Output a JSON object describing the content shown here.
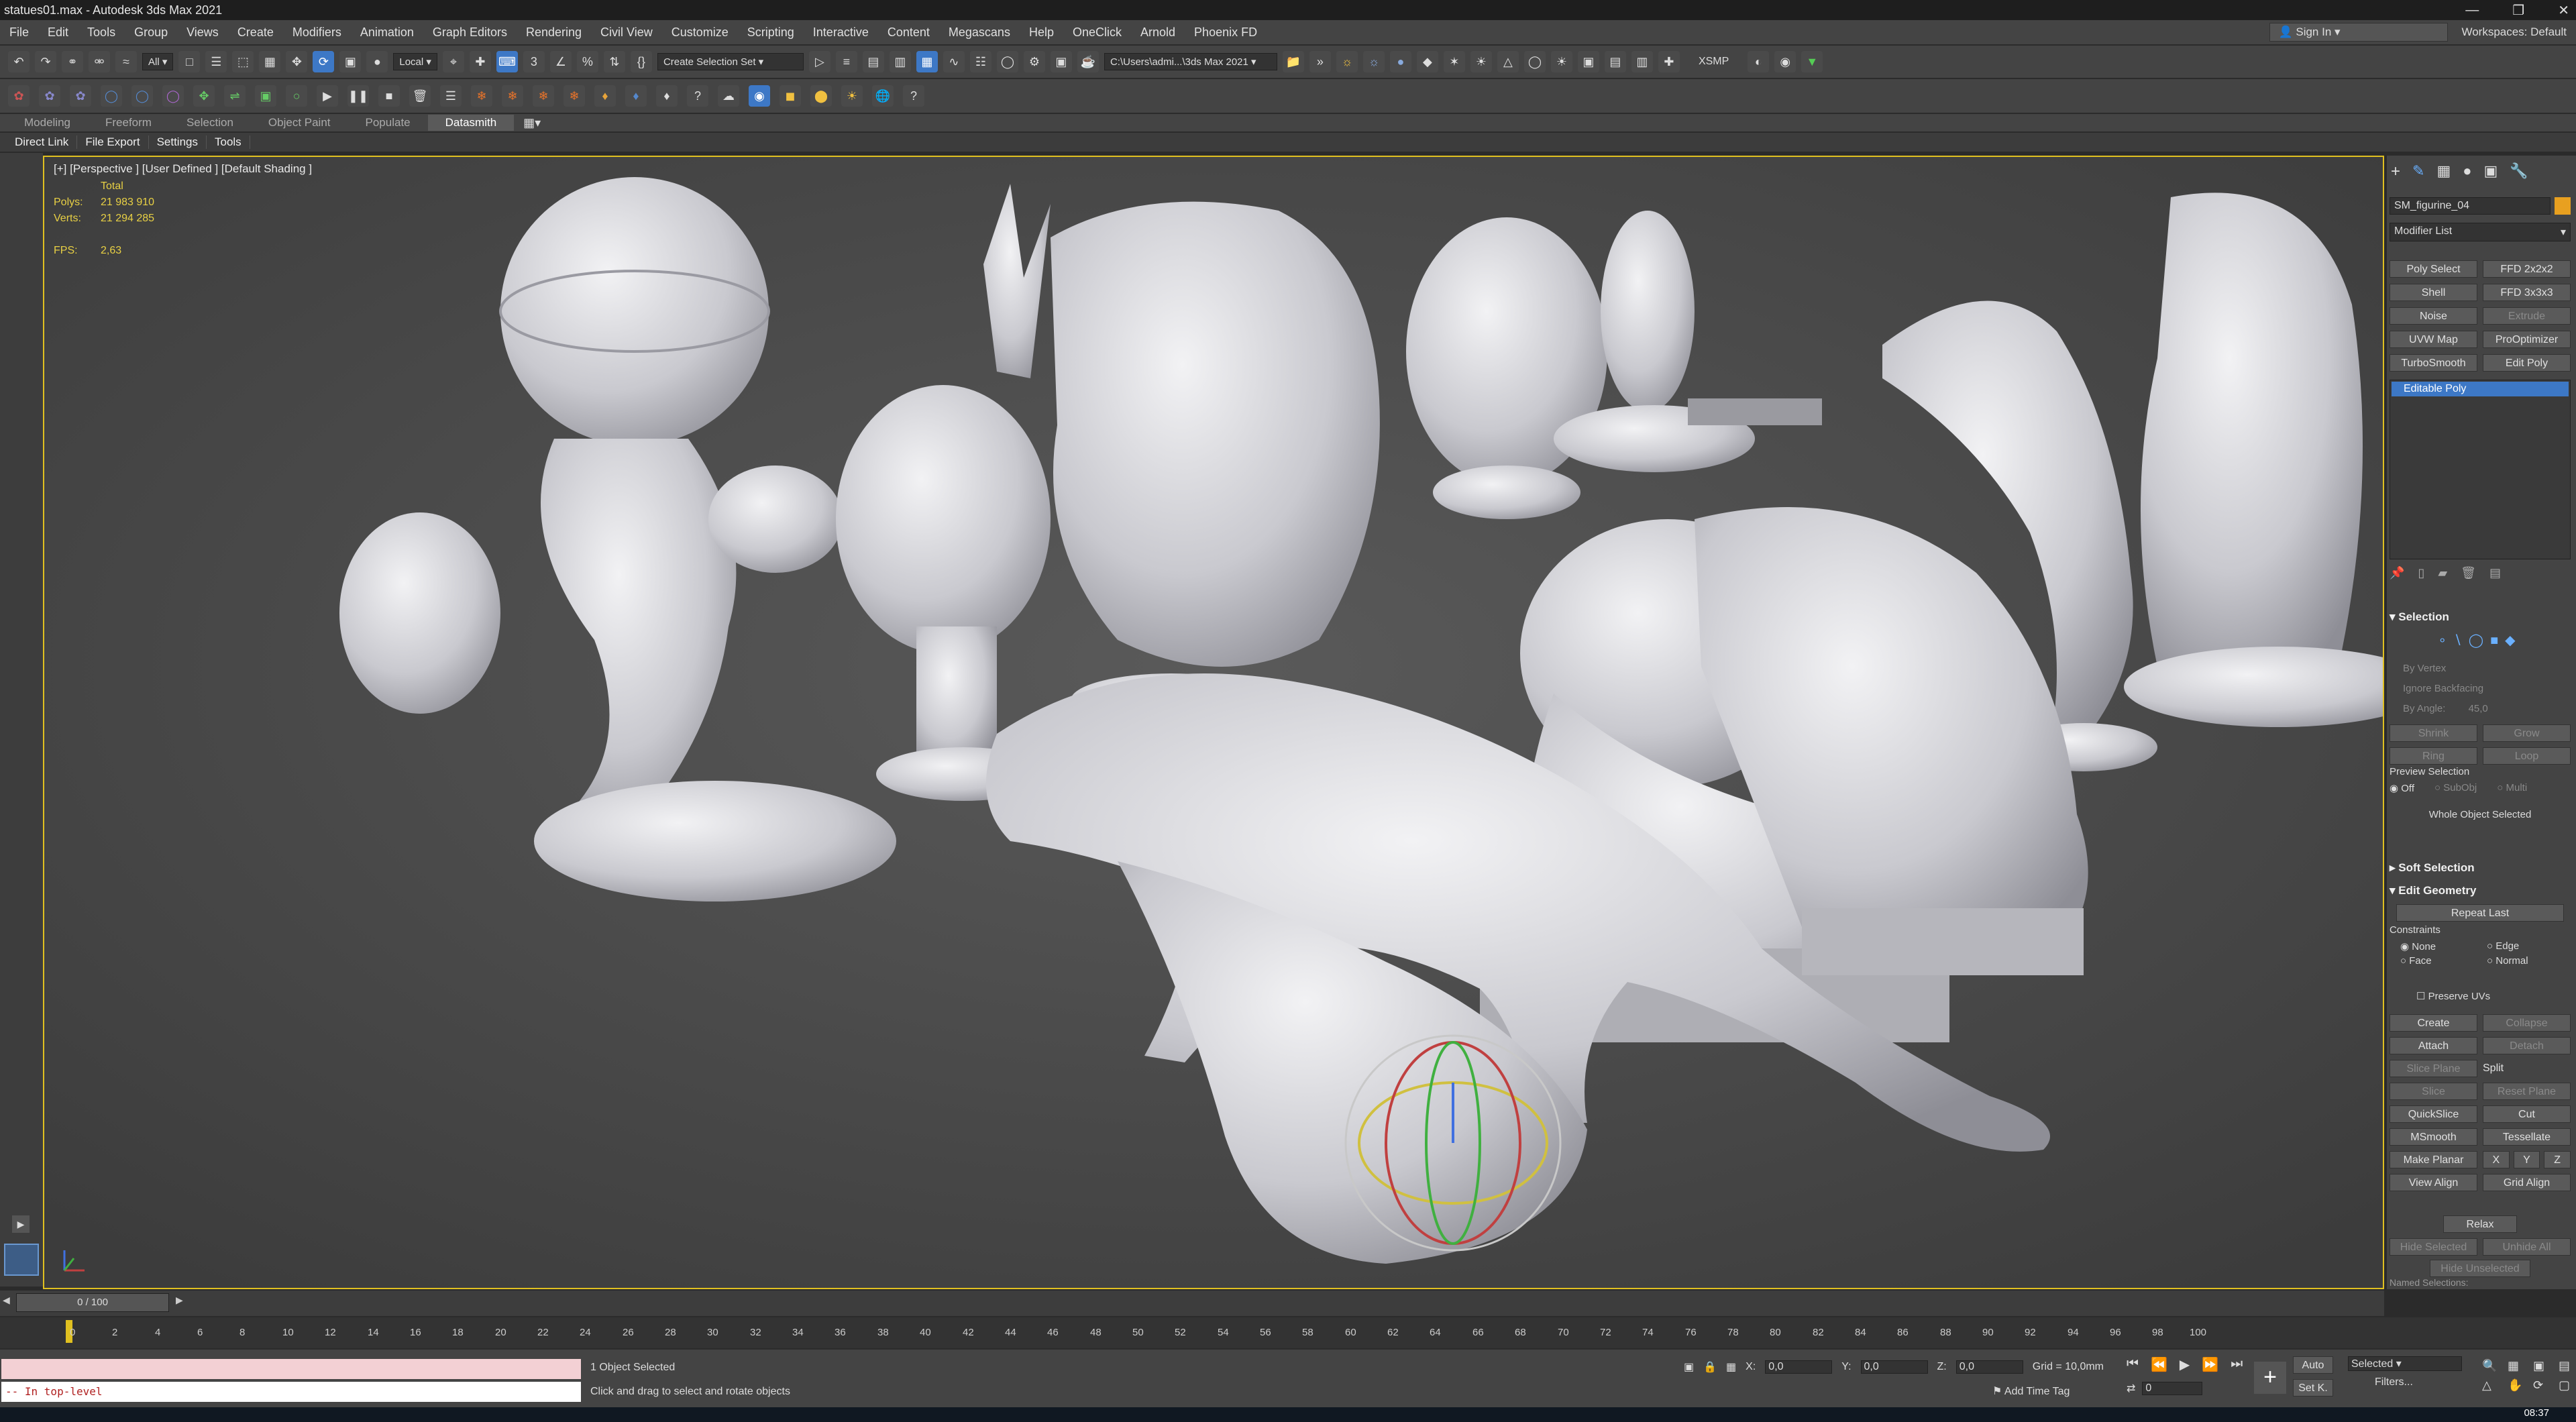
{
  "window": {
    "title": "statues01.max - Autodesk 3ds Max 2021"
  },
  "menu": [
    "File",
    "Edit",
    "Tools",
    "Group",
    "Views",
    "Create",
    "Modifiers",
    "Animation",
    "Graph Editors",
    "Rendering",
    "Civil View",
    "Customize",
    "Scripting",
    "Interactive",
    "Content",
    "Megascans",
    "Help",
    "OneClick",
    "Arnold",
    "Phoenix FD"
  ],
  "signin": "Sign In",
  "workspace": "Workspaces:  Default",
  "toolbar": {
    "selection_filter": "All",
    "coord_system": "Local",
    "selection_set": "Create Selection Set",
    "path": "C:\\Users\\admi...\\3ds Max 2021",
    "xsmp": "XSMP"
  },
  "ribbon_tabs": [
    "Modeling",
    "Freeform",
    "Selection",
    "Object Paint",
    "Populate",
    "Datasmith"
  ],
  "ribbon_active": "Datasmith",
  "sub_tabs": [
    "Direct Link",
    "File Export",
    "Settings",
    "Tools"
  ],
  "viewport": {
    "label": "[+] [Perspective ] [User Defined ] [Default Shading ]",
    "stats_header": "Total",
    "polys_label": "Polys:",
    "polys": "21 983 910",
    "verts_label": "Verts:",
    "verts": "21 294 285",
    "fps_label": "FPS:",
    "fps": "2,63"
  },
  "command_panel": {
    "object_name": "SM_figurine_04",
    "modifier_list": "Modifier List",
    "buttons": [
      [
        "Poly Select",
        "FFD 2x2x2"
      ],
      [
        "Shell",
        "FFD 3x3x3"
      ],
      [
        "Noise",
        "Extrude"
      ],
      [
        "UVW Map",
        "ProOptimizer"
      ],
      [
        "TurboSmooth",
        "Edit Poly"
      ]
    ],
    "stack_item": "Editable Poly",
    "selection_header": "Selection",
    "by_vertex": "By Vertex",
    "ignore_backfacing": "Ignore Backfacing",
    "by_angle": "By Angle:",
    "by_angle_value": "45,0",
    "shrink": "Shrink",
    "grow": "Grow",
    "ring": "Ring",
    "loop": "Loop",
    "preview_selection": "Preview Selection",
    "preview_opts": [
      "Off",
      "SubObj",
      "Multi"
    ],
    "whole_object": "Whole Object Selected",
    "soft_selection": "Soft Selection",
    "edit_geometry": "Edit Geometry",
    "repeat_last": "Repeat Last",
    "constraints": "Constraints",
    "constraint_opts": [
      "None",
      "Edge",
      "Face",
      "Normal"
    ],
    "preserve_uvs": "Preserve UVs",
    "create": "Create",
    "collapse": "Collapse",
    "attach": "Attach",
    "detach": "Detach",
    "slice_plane": "Slice Plane",
    "split": "Split",
    "slice": "Slice",
    "reset_plane": "Reset Plane",
    "quickslice": "QuickSlice",
    "cut": "Cut",
    "msmooth": "MSmooth",
    "tessellate": "Tessellate",
    "make_planar": "Make Planar",
    "x": "X",
    "y": "Y",
    "z": "Z",
    "view_align": "View Align",
    "grid_align": "Grid Align",
    "relax": "Relax",
    "hide_selected": "Hide Selected",
    "unhide_all": "Unhide All",
    "hide_unselected": "Hide Unselected",
    "named_selections": "Named Selections:"
  },
  "timeline": {
    "frame_display": "0 / 100",
    "ticks": [
      "0",
      "2",
      "4",
      "6",
      "8",
      "10",
      "12",
      "14",
      "16",
      "18",
      "20",
      "22",
      "24",
      "26",
      "28",
      "30",
      "32",
      "34",
      "36",
      "38",
      "40",
      "42",
      "44",
      "46",
      "48",
      "50",
      "52",
      "54",
      "56",
      "58",
      "60",
      "62",
      "64",
      "66",
      "68",
      "70",
      "72",
      "74",
      "76",
      "78",
      "80",
      "82",
      "84",
      "86",
      "88",
      "90",
      "92",
      "94",
      "96",
      "98",
      "100"
    ]
  },
  "status": {
    "listener": "-- In top-level",
    "objects_selected": "1 Object Selected",
    "prompt": "Click and drag to select and rotate objects",
    "x_label": "X:",
    "x_val": "0,0",
    "y_label": "Y:",
    "y_val": "0,0",
    "z_label": "Z:",
    "z_val": "0,0",
    "grid": "Grid = 10,0mm",
    "add_time_tag": "Add Time Tag",
    "auto": "Auto",
    "selected": "Selected",
    "set_key": "Set K.",
    "filters": "Filters...",
    "frame": "0"
  },
  "taskbar": {
    "time": "08:37"
  },
  "colors": {
    "accent_blue": "#3d78c6",
    "viewport_bg": "#505050",
    "active_border": "#e0c020"
  }
}
